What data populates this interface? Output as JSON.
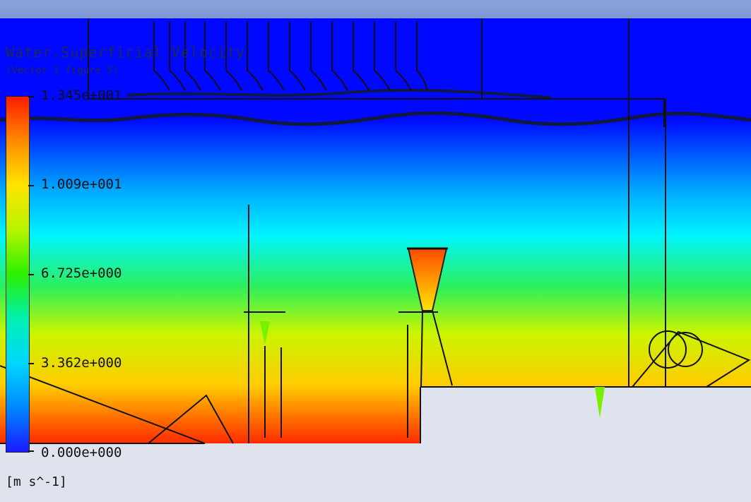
{
  "legend": {
    "title": "Water.Superficial Velocity",
    "subtitle": "(Vector 1 figure 5)",
    "ticks": [
      "1.345e+001",
      "1.009e+001",
      "6.725e+000",
      "3.362e+000",
      "0.000e+000"
    ],
    "units": "[m s^-1]"
  },
  "colors": {
    "scale_high": "#ff1a00",
    "scale_mid": "#2bf000",
    "scale_low": "#1a1aff",
    "background": "#dfe3ee",
    "geometry_lines": "#111111"
  }
}
